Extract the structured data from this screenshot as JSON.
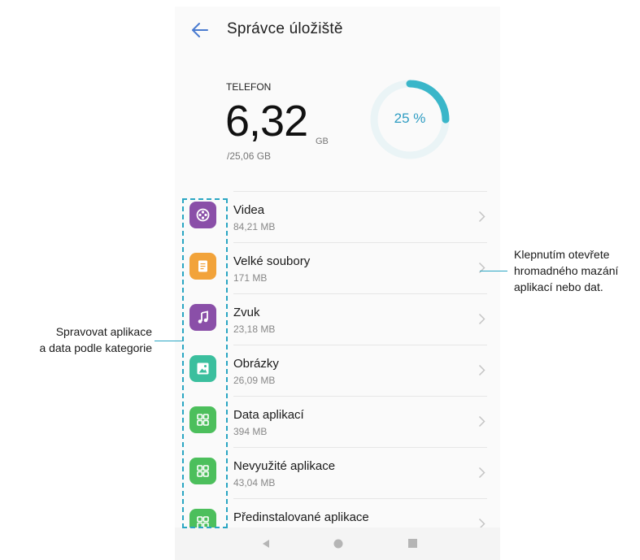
{
  "header": {
    "title": "Správce úložiště",
    "back_icon": "back-arrow-icon"
  },
  "storage": {
    "label": "TELEFON",
    "used": "6,32",
    "unit": "GB",
    "total": "/25,06 GB",
    "percent_label": "25 %",
    "percent_value": 0.25,
    "accent_color": "#3ab6c9",
    "track_color": "#eaf4f6"
  },
  "categories": [
    {
      "title": "Videa",
      "size": "84,21 MB",
      "icon": "video-icon",
      "color": "#8a4fa8"
    },
    {
      "title": "Velké soubory",
      "size": "171 MB",
      "icon": "document-icon",
      "color": "#f2a33a"
    },
    {
      "title": "Zvuk",
      "size": "23,18 MB",
      "icon": "music-note-icon",
      "color": "#8a4fa8"
    },
    {
      "title": "Obrázky",
      "size": "26,09 MB",
      "icon": "image-icon",
      "color": "#3bbf9e"
    },
    {
      "title": "Data aplikací",
      "size": "394 MB",
      "icon": "app-grid-icon",
      "color": "#4cbf5c"
    },
    {
      "title": "Nevyužité aplikace",
      "size": "43,04 MB",
      "icon": "app-grid-icon",
      "color": "#4cbf5c"
    },
    {
      "title": "Předinstalované aplikace",
      "size": "",
      "icon": "app-grid-icon",
      "color": "#4cbf5c"
    }
  ],
  "navigation": {
    "back_icon": "nav-back-icon",
    "home_icon": "nav-home-icon",
    "recent_icon": "nav-recent-icon"
  },
  "annotations": {
    "left": [
      "Spravovat aplikace",
      "a data podle kategorie"
    ],
    "right": [
      "Klepnutím otevřete",
      "hromadného mazání",
      "aplikací nebo dat."
    ],
    "line_color": "#2aa6c3"
  }
}
